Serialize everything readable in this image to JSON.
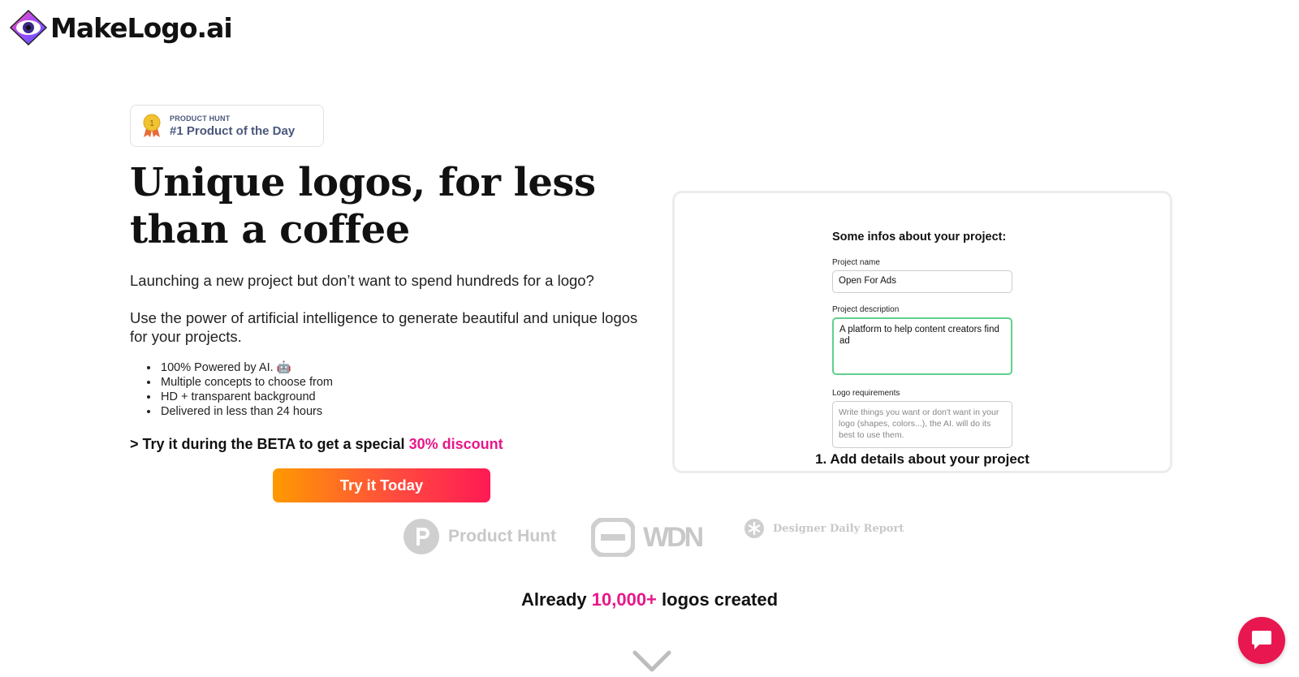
{
  "brand": {
    "name": "MakeLogo.ai"
  },
  "badge": {
    "source": "PRODUCT HUNT",
    "title": "#1 Product of the Day",
    "rank": "1"
  },
  "hero": {
    "headline": "Unique logos, for less than a coffee",
    "subtitle1": "Launching a new project but don’t want to spend hundreds for a logo?",
    "subtitle2": "Use the power of artificial intelligence to generate beautiful and unique logos for your projects.",
    "features": [
      "100% Powered by AI. 🤖",
      "Multiple concepts to choose from",
      "HD + transparent background",
      "Delivered in less than 24 hours"
    ],
    "beta_prefix": "> Try it during the BETA to get a special ",
    "beta_discount": "30% discount",
    "cta_label": "Try it Today"
  },
  "demo": {
    "form_title": "Some infos about your project:",
    "project_name_label": "Project name",
    "project_name_value": "Open For Ads",
    "project_description_label": "Project description",
    "project_description_value": "A platform to help content creators find ad",
    "logo_requirements_label": "Logo requirements",
    "logo_requirements_placeholder": "Write things you want or don't want in your logo (shapes, colors...), the AI. will do its best to use them.",
    "caption": "1. Add details about your project"
  },
  "press": {
    "items": [
      "Product Hunt",
      "WDN",
      "Designer Daily Report"
    ]
  },
  "stats": {
    "prefix": "Already ",
    "count": "10,000+",
    "suffix": " logos created"
  },
  "colors": {
    "accent": "#e8178a",
    "cta_start": "#ff9a00",
    "cta_end": "#ff1a55",
    "focus": "#5fd08e",
    "chat": "#e8174f"
  }
}
